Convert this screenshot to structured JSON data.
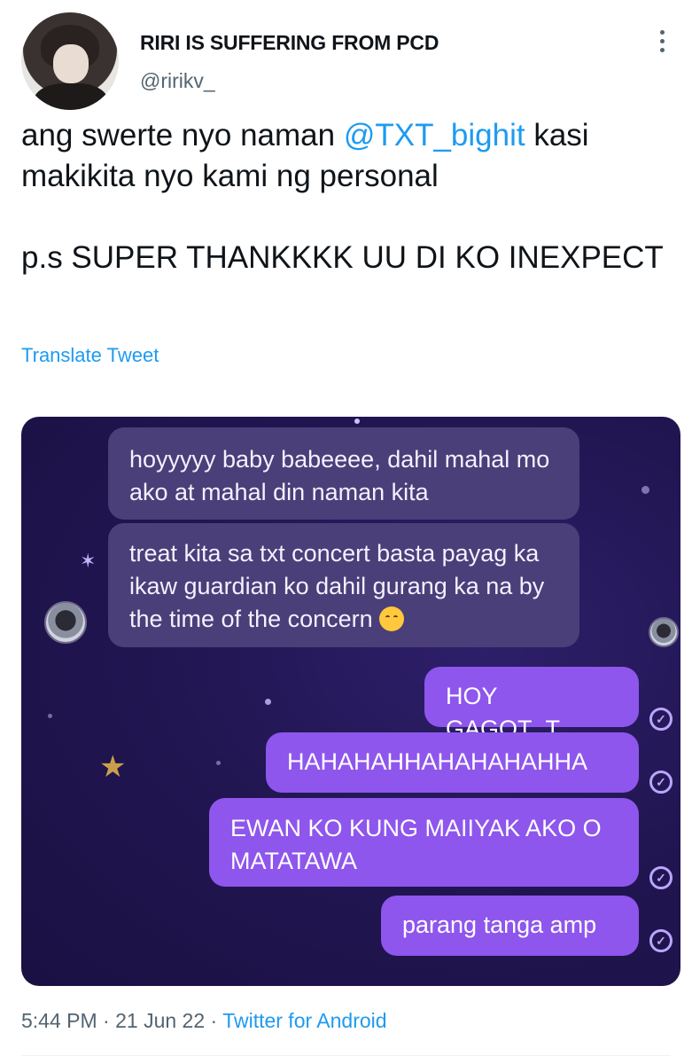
{
  "author": {
    "display_name": "RIRI IS SUFFERING FROM PCD",
    "handle": "@ririkv_"
  },
  "tweet": {
    "text_before_mention": "ang swerte nyo naman ",
    "mention": "@TXT_bighit",
    "text_after_mention": " kasi makikita nyo kami ng personal\n\np.s SUPER THANKKKK UU DI KO INEXPECT",
    "translate_label": "Translate Tweet"
  },
  "media": {
    "received_messages": [
      "hoyyyyy baby babeeee, dahil mahal mo ako at mahal din naman kita",
      "treat kita sa txt concert basta payag ka ikaw guardian ko dahil gurang ka na by the time of the concern"
    ],
    "sent_messages": [
      "HOY GAGOT_T",
      "HAHAHAHHAHAHAHAHHA",
      "EWAN KO KUNG MAIIYAK AKO O MATATAWA",
      "parang tanga amp"
    ],
    "emoji_icon": "smirking-face-emoji",
    "background_color": "#221653",
    "sent_bubble_color": "#8e56ec",
    "received_bubble_color": "#4a3f78"
  },
  "footer": {
    "time": "5:44 PM",
    "separator": "·",
    "date": "21 Jun 22",
    "source": "Twitter for Android"
  },
  "colors": {
    "link": "#1d9bf0",
    "secondary_text": "#536471"
  }
}
